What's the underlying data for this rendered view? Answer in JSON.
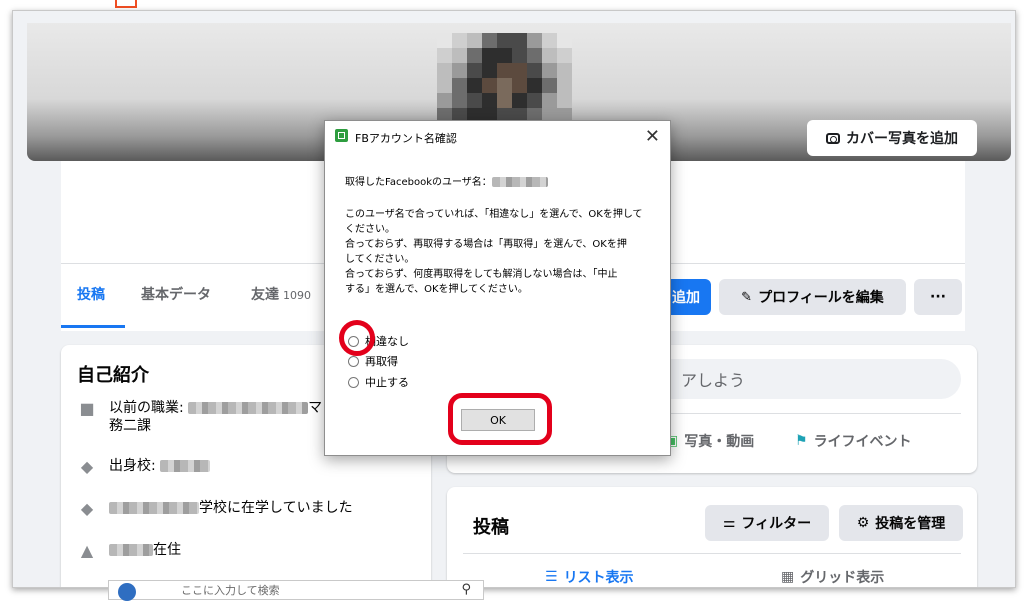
{
  "colors": {
    "accent": "#1877f2",
    "highlight": "#e3001b",
    "page_bg": "#f0f2f5",
    "app_icon": "#2e9d3f"
  },
  "cover": {
    "add_cover_label": "カバー写真を追加",
    "camera_icon": "camera-icon"
  },
  "tabs": [
    {
      "label": "投稿",
      "active": true
    },
    {
      "label": "基本データ"
    },
    {
      "label": "友達",
      "count": "1090"
    }
  ],
  "profile_actions": {
    "add_label": "追加",
    "edit_label": "プロフィールを編集",
    "more_label": "···",
    "pencil_icon": "pencil-icon"
  },
  "intro": {
    "title": "自己紹介",
    "items": [
      {
        "icon": "briefcase-icon",
        "label": "以前の職業:",
        "tail": "マ",
        "line2": "務二課"
      },
      {
        "icon": "graduation-cap-icon",
        "label": "出身校:"
      },
      {
        "icon": "graduation-cap-icon",
        "label": "学校に在学していました"
      },
      {
        "icon": "home-icon",
        "label": "在住"
      }
    ]
  },
  "composer": {
    "placeholder_tail": "アしよう",
    "photo_label": "写真・動画",
    "life_event_label": "ライフイベント"
  },
  "posts": {
    "title": "投稿",
    "filter_label": "フィルター",
    "manage_label": "投稿を管理",
    "list_view_label": "リスト表示",
    "grid_view_label": "グリッド表示"
  },
  "taskbar": {
    "search_placeholder": "ここに入力して検索"
  },
  "dialog": {
    "title": "FBアカウント名確認",
    "fetched_label": "取得したFacebookのユーザ名：",
    "message_lines": [
      "このユーザ名で合っていれば、「相違なし」を選んで、OKを押して",
      "ください。",
      "合っておらず、再取得する場合は「再取得」を選んで、OKを押",
      "してください。",
      "合っておらず、何度再取得をしても解消しない場合は、「中止",
      "する」を選んで、OKを押してください。"
    ],
    "options": [
      "相違なし",
      "再取得",
      "中止する"
    ],
    "ok_label": "OK",
    "close_label": "✕"
  }
}
